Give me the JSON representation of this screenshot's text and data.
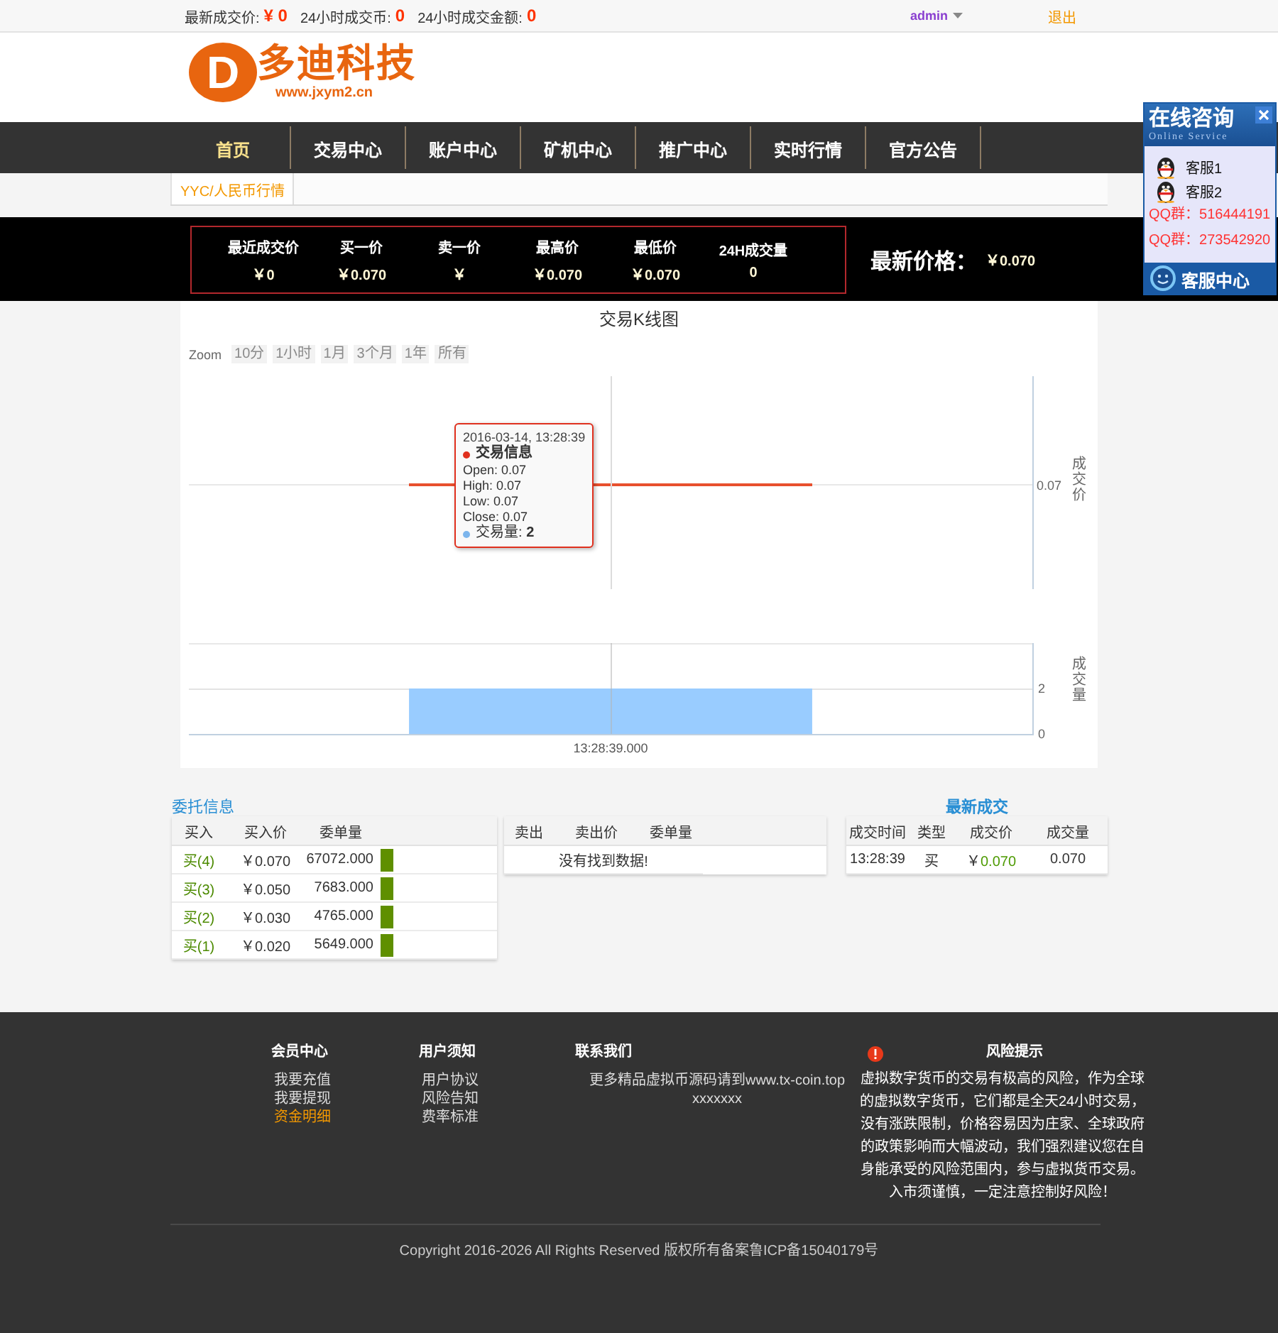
{
  "top_bar": {
    "stats": [
      {
        "label": "最新成交价:",
        "value": "¥ 0"
      },
      {
        "label": "24小时成交币:",
        "value": "0"
      },
      {
        "label": "24小时成交金额:",
        "value": "0"
      }
    ],
    "user": "admin",
    "logout": "退出"
  },
  "logo": {
    "letter": "D",
    "name": "多迪科技",
    "url": "www.jxym2.cn"
  },
  "nav": [
    {
      "label": "首页",
      "selected": true
    },
    {
      "label": "交易中心",
      "selected": false
    },
    {
      "label": "账户中心",
      "selected": false
    },
    {
      "label": "矿机中心",
      "selected": false
    },
    {
      "label": "推广中心",
      "selected": false
    },
    {
      "label": "实时行情",
      "selected": false
    },
    {
      "label": "官方公告",
      "selected": false
    }
  ],
  "market_tabs": [
    {
      "label": "YYC/人民币行情",
      "selected": true
    }
  ],
  "ticker": {
    "stats": [
      {
        "label": "最近成交价",
        "value": "￥0"
      },
      {
        "label": "买一价",
        "value": "￥0.070"
      },
      {
        "label": "卖一价",
        "value": "￥"
      },
      {
        "label": "最高价",
        "value": "￥0.070"
      },
      {
        "label": "最低价",
        "value": "￥0.070"
      },
      {
        "label": "24H成交量",
        "value": "0"
      }
    ],
    "latest_label": "最新价格：",
    "latest_value": "￥0.070"
  },
  "kline": {
    "title": "交易K线图",
    "zoom_label": "Zoom",
    "zoom_buttons": [
      "10分",
      "1小时",
      "1月",
      "3个月",
      "1年",
      "所有"
    ],
    "price_axis": {
      "tick": "0.07",
      "title": "成交价"
    },
    "tooltip": {
      "time": "2016-03-14, 13:28:39",
      "items": [
        {
          "kind": "ohlc",
          "label": "交易信息",
          "color": "#e0301e",
          "lines": [
            "Open: 0.07",
            "High: 0.07",
            "Low: 0.07",
            "Close: 0.07"
          ]
        },
        {
          "kind": "value",
          "label": "交易量: **2**",
          "color": "#7cb5ec"
        }
      ]
    },
    "volume_chart": {
      "chart_data": {
        "type": "bar",
        "ylabel": "成交量",
        "categories": [
          "13:28:39.000"
        ],
        "values": [
          2
        ],
        "ylim": [
          0,
          4
        ],
        "yticks": [
          0,
          2
        ]
      }
    }
  },
  "orders": {
    "title": "委托信息",
    "buy": {
      "columns": [
        "买入",
        "买入价",
        "委单量"
      ],
      "rows": [
        {
          "side": "买(4)",
          "price": "￥0.070",
          "amount": "67072.000"
        },
        {
          "side": "买(3)",
          "price": "￥0.050",
          "amount": "7683.000"
        },
        {
          "side": "买(2)",
          "price": "￥0.030",
          "amount": "4765.000"
        },
        {
          "side": "买(1)",
          "price": "￥0.020",
          "amount": "5649.000"
        }
      ]
    },
    "sell": {
      "columns": [
        "卖出",
        "卖出价",
        "委单量"
      ],
      "empty_text": "没有找到数据!"
    }
  },
  "trades": {
    "title": "最新成交",
    "columns": [
      "成交时间",
      "类型",
      "成交价",
      "成交量"
    ],
    "rows": [
      {
        "time": "13:28:39",
        "type": "买",
        "currency": "￥",
        "price": "0.070",
        "amount": "0.070"
      }
    ]
  },
  "footer": {
    "columns": [
      {
        "title": "会员中心",
        "links": [
          {
            "label": "我要充值",
            "selected": false
          },
          {
            "label": "我要提现",
            "selected": false
          },
          {
            "label": "资金明细",
            "selected": true
          }
        ]
      },
      {
        "title": "用户须知",
        "links": [
          {
            "label": "用户协议",
            "selected": false
          },
          {
            "label": "风险告知",
            "selected": false
          },
          {
            "label": "费率标准",
            "selected": false
          }
        ]
      }
    ],
    "contact": {
      "title": "联系我们",
      "lines": [
        "更多精品虚拟币源码请到www.tx-coin.top",
        "xxxxxxx"
      ]
    },
    "risk": {
      "title": "风险提示",
      "text": "虚拟数字货币的交易有极高的风险，作为全球的虚拟数字货币，它们都是全天24小时交易，没有涨跌限制，价格容易因为庄家、全球政府的政策影响而大幅波动，我们强烈建议您在自身能承受的风险范围内，参与虚拟货币交易。入市须谨慎，一定注意控制好风险！"
    },
    "copyright": "Copyright 2016-2026 All Rights Reserved 版权所有备案鲁ICP备15040179号"
  },
  "online_service": {
    "title": "在线咨询",
    "subtitle": "Online Service",
    "agents": [
      "客服1",
      "客服2"
    ],
    "groups": [
      "QQ群：516444191",
      "QQ群：273542920"
    ],
    "footer": "客服中心"
  }
}
